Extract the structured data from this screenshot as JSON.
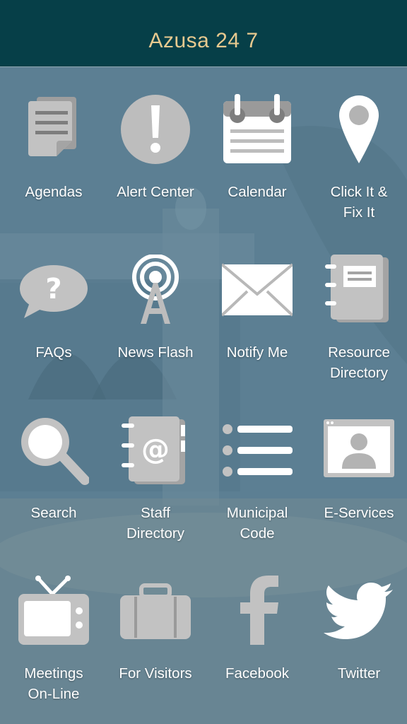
{
  "header": {
    "title": "Azusa 24 7"
  },
  "colors": {
    "header_bg": "#063f48",
    "title": "#e7c98f",
    "icon": "#b9b9b9",
    "label": "#ffffff"
  },
  "tiles": [
    {
      "label": "Agendas",
      "icon": "document-icon"
    },
    {
      "label": "Alert Center",
      "icon": "exclamation-icon"
    },
    {
      "label": "Calendar",
      "icon": "calendar-icon"
    },
    {
      "label": "Click It &\nFix It",
      "icon": "map-pin-icon"
    },
    {
      "label": "FAQs",
      "icon": "question-bubble-icon"
    },
    {
      "label": "News Flash",
      "icon": "broadcast-tower-icon"
    },
    {
      "label": "Notify Me",
      "icon": "envelope-icon"
    },
    {
      "label": "Resource\nDirectory",
      "icon": "notebook-icon"
    },
    {
      "label": "Search",
      "icon": "magnifier-icon"
    },
    {
      "label": "Staff\nDirectory",
      "icon": "address-book-icon"
    },
    {
      "label": "Municipal\nCode",
      "icon": "list-icon"
    },
    {
      "label": "E-Services",
      "icon": "browser-user-icon"
    },
    {
      "label": "Meetings\nOn-Line",
      "icon": "television-icon"
    },
    {
      "label": "For Visitors",
      "icon": "suitcase-icon"
    },
    {
      "label": "Facebook",
      "icon": "facebook-icon"
    },
    {
      "label": "Twitter",
      "icon": "twitter-bird-icon"
    }
  ]
}
